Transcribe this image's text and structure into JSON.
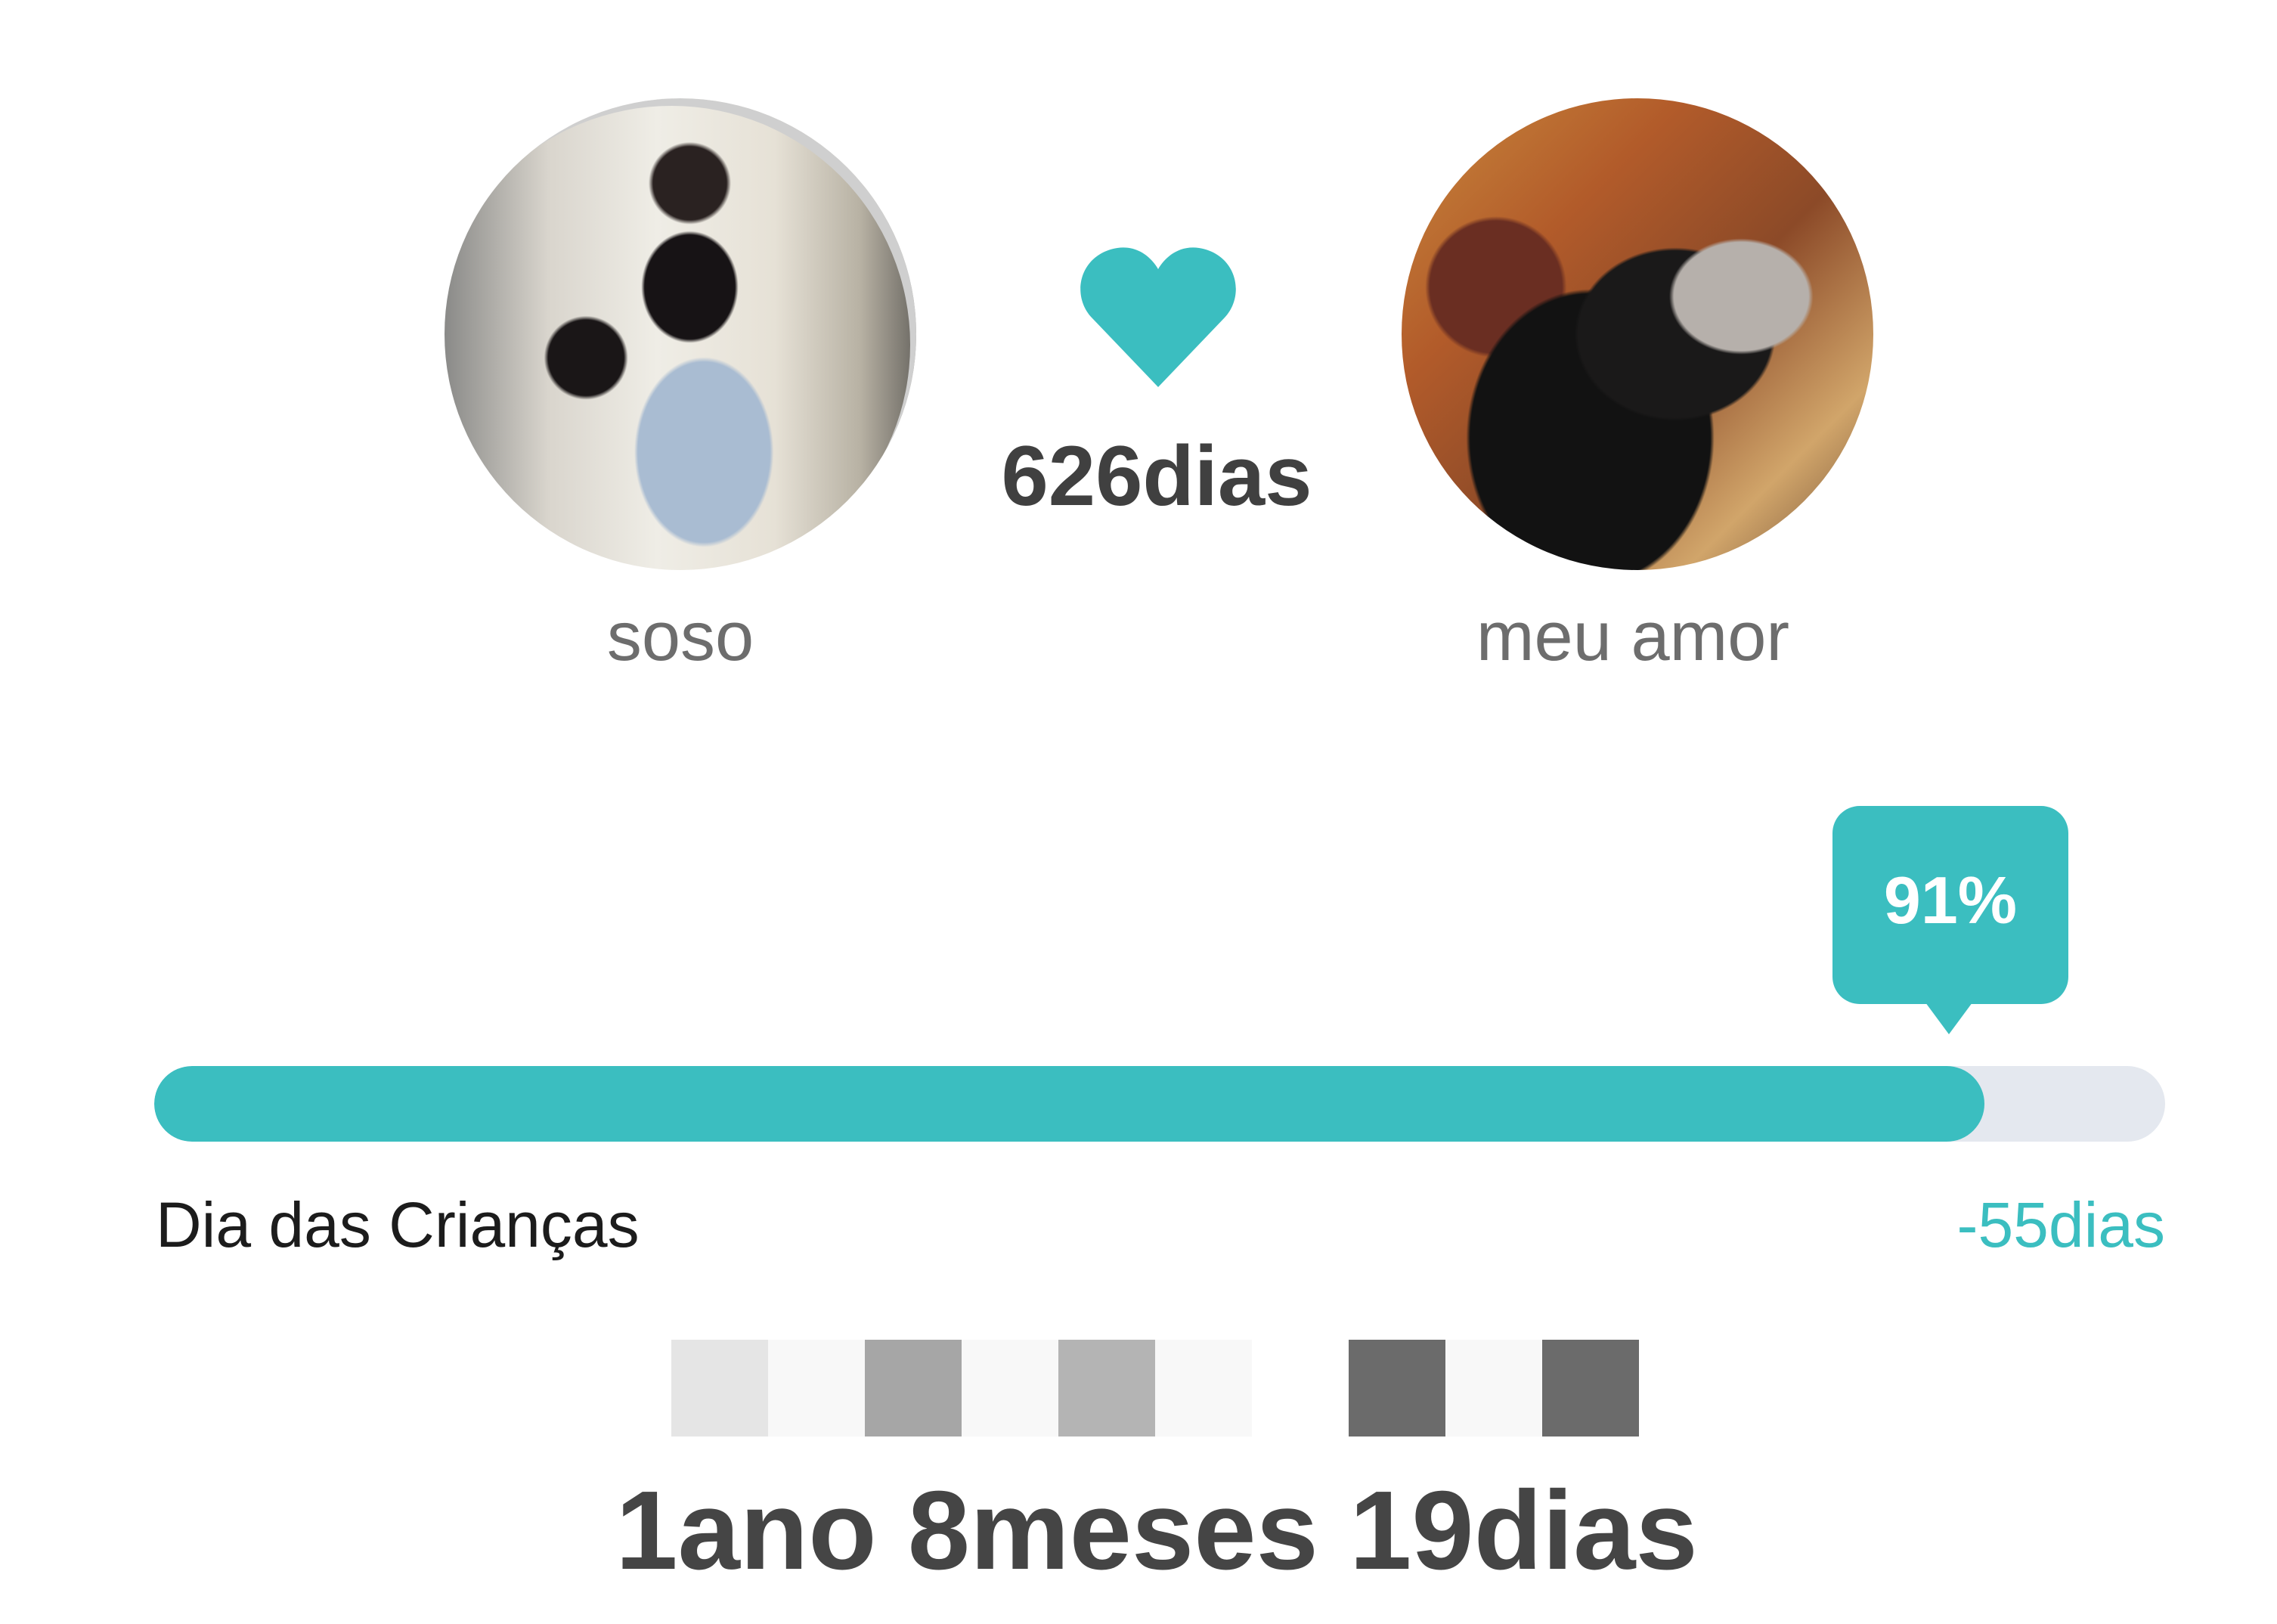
{
  "couple": {
    "left": {
      "name": "soso"
    },
    "right": {
      "name": "meu amor"
    }
  },
  "days_together": "626dias",
  "progress": {
    "percent_label": "91%",
    "fraction": 0.91,
    "event_name": "Dia das Crianças",
    "remaining": "-55dias"
  },
  "duration": "1ano 8meses 19dias",
  "colors": {
    "accent": "#3bbec0",
    "track": "#e4e8ef",
    "text_dark": "#404040",
    "text_muted": "#6d6d6d"
  }
}
